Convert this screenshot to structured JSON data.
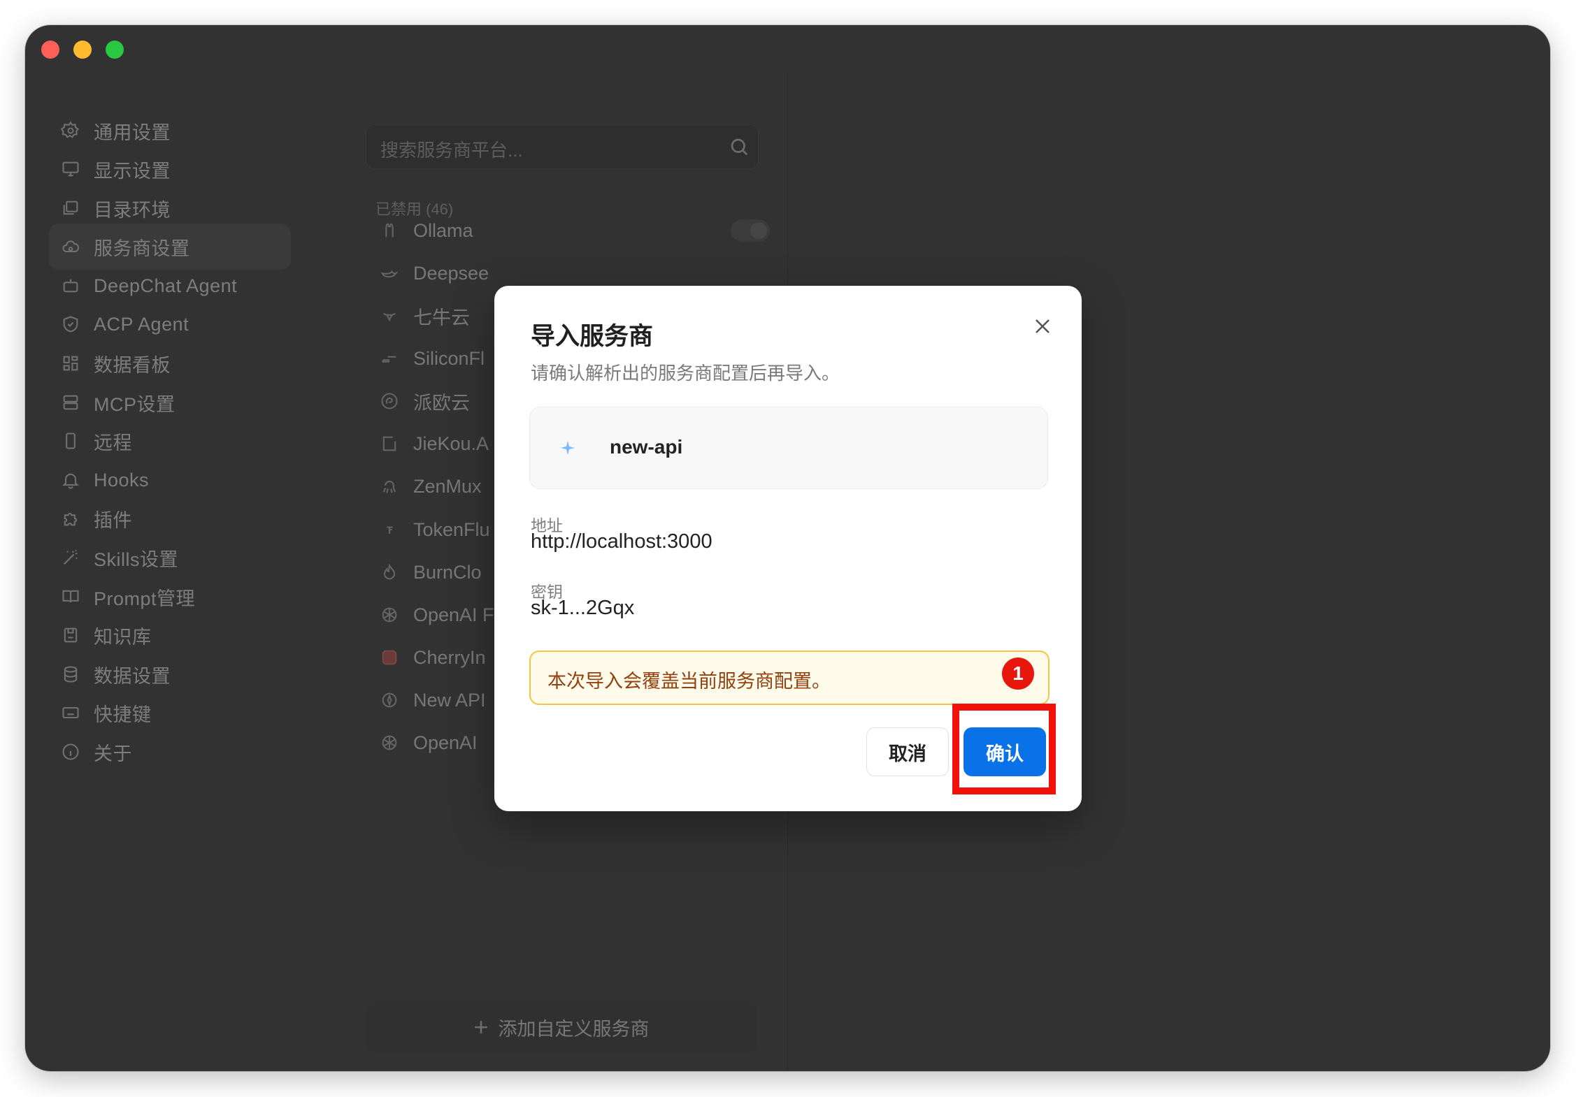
{
  "sidebar": {
    "items": [
      {
        "label": "通用设置",
        "icon": "gear-icon"
      },
      {
        "label": "显示设置",
        "icon": "monitor-icon"
      },
      {
        "label": "目录环境",
        "icon": "folder-icon"
      },
      {
        "label": "服务商设置",
        "icon": "cloud-icon",
        "active": true
      },
      {
        "label": "DeepChat Agent",
        "icon": "bot-icon"
      },
      {
        "label": "ACP Agent",
        "icon": "shield-icon"
      },
      {
        "label": "数据看板",
        "icon": "dashboard-icon"
      },
      {
        "label": "MCP设置",
        "icon": "server-icon"
      },
      {
        "label": "远程",
        "icon": "phone-icon"
      },
      {
        "label": "Hooks",
        "icon": "bell-icon"
      },
      {
        "label": "插件",
        "icon": "puzzle-icon"
      },
      {
        "label": "Skills设置",
        "icon": "wand-icon"
      },
      {
        "label": "Prompt管理",
        "icon": "book-icon"
      },
      {
        "label": "知识库",
        "icon": "save-icon"
      },
      {
        "label": "数据设置",
        "icon": "database-icon"
      },
      {
        "label": "快捷键",
        "icon": "keyboard-icon"
      },
      {
        "label": "关于",
        "icon": "info-icon"
      }
    ]
  },
  "providers": {
    "search_placeholder": "搜索服务商平台...",
    "section_label": "已禁用 (46)",
    "items": [
      {
        "label": "Ollama",
        "icon": "llama-icon"
      },
      {
        "label": "Deepsee",
        "icon": "whale-icon"
      },
      {
        "label": "七牛云",
        "icon": "bull-icon"
      },
      {
        "label": "SiliconFl",
        "icon": "bars-icon"
      },
      {
        "label": "派欧云",
        "icon": "spiral-icon"
      },
      {
        "label": "JieKou.A",
        "icon": "bracket-icon"
      },
      {
        "label": "ZenMux",
        "icon": "octopus-icon"
      },
      {
        "label": "TokenFlu",
        "icon": "flag-icon"
      },
      {
        "label": "BurnClo",
        "icon": "flame-icon"
      },
      {
        "label": "OpenAI F",
        "icon": "openai-icon"
      },
      {
        "label": "CherryIn",
        "icon": "cherryin-icon"
      },
      {
        "label": "New API",
        "icon": "newapi-icon"
      },
      {
        "label": "OpenAI",
        "icon": "openai-icon"
      }
    ],
    "add_label": "添加自定义服务商"
  },
  "dialog": {
    "title": "导入服务商",
    "subtitle": "请确认解析出的服务商配置后再导入。",
    "provider_name": "new-api",
    "address_label": "地址",
    "address_value": "http://localhost:3000",
    "key_label": "密钥",
    "key_value": "sk-1...2Gqx",
    "warning": "本次导入会覆盖当前服务商配置。",
    "badge": "1",
    "cancel_label": "取消",
    "confirm_label": "确认"
  },
  "colors": {
    "accent": "#0a72e9",
    "highlight": "#f0120a",
    "warning_border": "#f5c542",
    "badge": "#e8170d"
  }
}
